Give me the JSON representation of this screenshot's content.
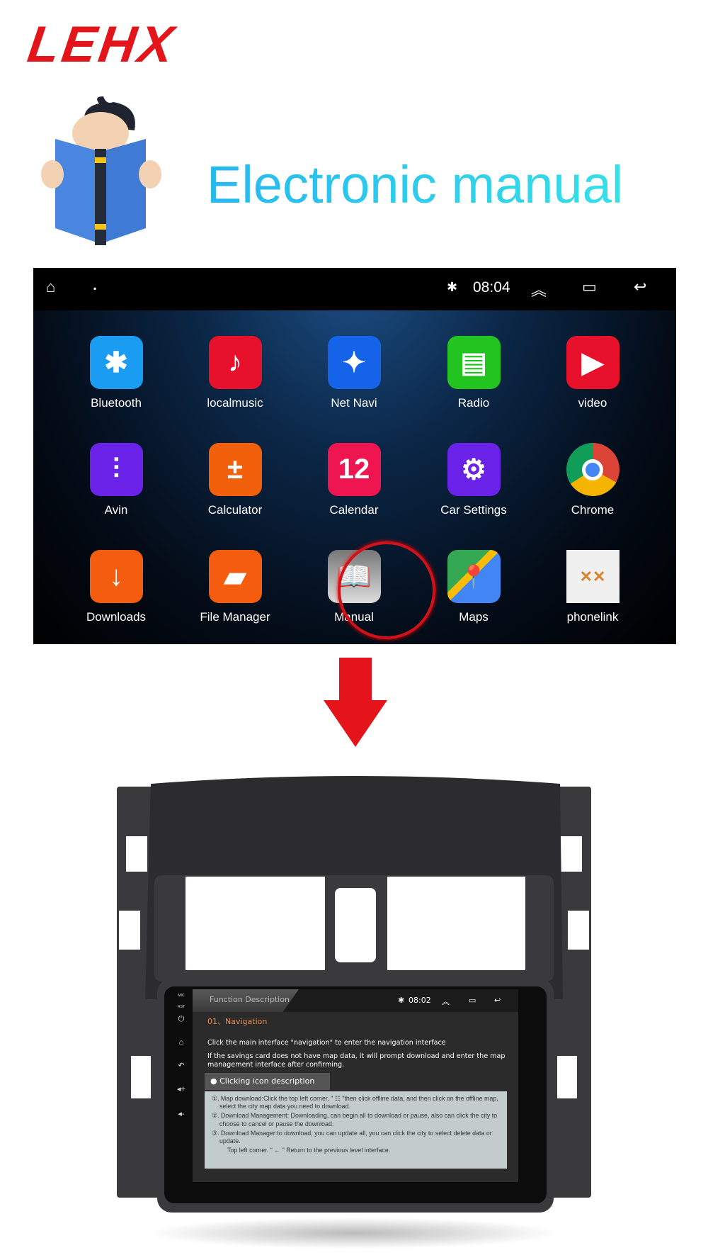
{
  "brand": {
    "logo": "LEHX"
  },
  "header": {
    "title": "Electronic manual",
    "illustration": "reading-book-icon"
  },
  "launcher": {
    "status": {
      "time": "08:04"
    },
    "apps": [
      {
        "label": "Bluetooth",
        "icon": "bluetooth-icon",
        "color": "#1a9cf2"
      },
      {
        "label": "localmusic",
        "icon": "music-note-icon",
        "color": "#e8112b"
      },
      {
        "label": "Net Navi",
        "icon": "compass-icon",
        "color": "#1463e8"
      },
      {
        "label": "Radio",
        "icon": "radio-icon",
        "color": "#22c520"
      },
      {
        "label": "video",
        "icon": "play-icon",
        "color": "#e8112b"
      },
      {
        "label": "Avin",
        "icon": "av-cable-icon",
        "color": "#6a22e8"
      },
      {
        "label": "Calculator",
        "icon": "calculator-icon",
        "color": "#f2600c"
      },
      {
        "label": "Calendar",
        "icon": "calendar-icon",
        "color": "#ef1550"
      },
      {
        "label": "Car Settings",
        "icon": "gear-icon",
        "color": "#6a22e8"
      },
      {
        "label": "Chrome",
        "icon": "chrome-icon",
        "color": "#ffffff"
      },
      {
        "label": "Downloads",
        "icon": "download-arrow-icon",
        "color": "#f45d10"
      },
      {
        "label": "File Manager",
        "icon": "folder-icon",
        "color": "#f45d10"
      },
      {
        "label": "Manual",
        "icon": "book-icon",
        "color": "#9a9a9a"
      },
      {
        "label": "Maps",
        "icon": "maps-icon",
        "color": "#ffffff"
      },
      {
        "label": "phonelink",
        "icon": "phonelink-icon",
        "color": "#f0f0f0"
      }
    ],
    "highlight": "Manual"
  },
  "manual_screen": {
    "tab": "Function Description",
    "time": "08:02",
    "heading": "01、Navigation",
    "line1": "Click the main interface \"navigation\" to enter the navigation interface",
    "line2": "If the savings card does not have map data, it will prompt download and enter the map management interface after confirming.",
    "section": "Clicking icon description",
    "items": [
      "①. Map download:Click the top left corner, \" ☷ \"then click offline data, and then click on the offline map, select the city map data you need to download.",
      "②. Download Management: Downloading, can begin all to download or pause, also can click the city to choose to cancel or pause the download.",
      "③. Download Manager:to download, you can update all, you can click the city to select delete data or update.",
      "Top left corner. \" ← \" Return to the previous level interface."
    ],
    "side_labels": [
      "MIC",
      "RST"
    ]
  }
}
